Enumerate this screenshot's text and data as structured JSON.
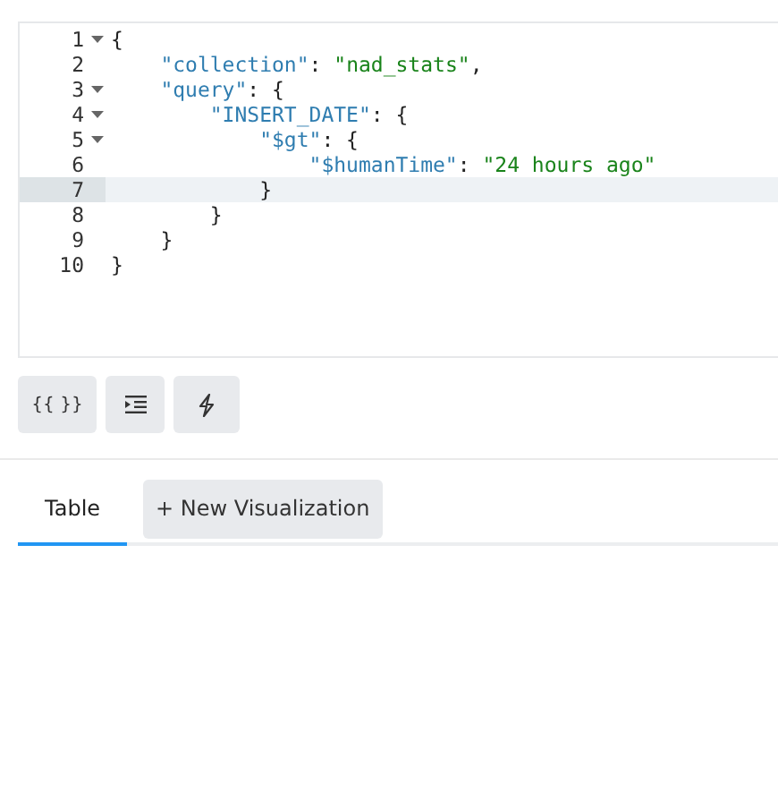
{
  "editor": {
    "lines": [
      {
        "number": "1",
        "foldable": true,
        "active": false,
        "tokens": [
          {
            "kind": "punct",
            "text": "{"
          }
        ]
      },
      {
        "number": "2",
        "foldable": false,
        "active": false,
        "tokens": [
          {
            "kind": "key",
            "text": "    \"collection\""
          },
          {
            "kind": "punct",
            "text": ": "
          },
          {
            "kind": "string",
            "text": "\"nad_stats\""
          },
          {
            "kind": "punct",
            "text": ","
          }
        ]
      },
      {
        "number": "3",
        "foldable": true,
        "active": false,
        "tokens": [
          {
            "kind": "key",
            "text": "    \"query\""
          },
          {
            "kind": "punct",
            "text": ": {"
          }
        ]
      },
      {
        "number": "4",
        "foldable": true,
        "active": false,
        "tokens": [
          {
            "kind": "key",
            "text": "        \"INSERT_DATE\""
          },
          {
            "kind": "punct",
            "text": ": {"
          }
        ]
      },
      {
        "number": "5",
        "foldable": true,
        "active": false,
        "tokens": [
          {
            "kind": "key",
            "text": "            \"$gt\""
          },
          {
            "kind": "punct",
            "text": ": {"
          }
        ]
      },
      {
        "number": "6",
        "foldable": false,
        "active": false,
        "tokens": [
          {
            "kind": "key",
            "text": "                \"$humanTime\""
          },
          {
            "kind": "punct",
            "text": ": "
          },
          {
            "kind": "string",
            "text": "\"24 hours ago\""
          }
        ]
      },
      {
        "number": "7",
        "foldable": false,
        "active": true,
        "tokens": [
          {
            "kind": "punct",
            "text": "            }"
          }
        ]
      },
      {
        "number": "8",
        "foldable": false,
        "active": false,
        "tokens": [
          {
            "kind": "punct",
            "text": "        }"
          }
        ]
      },
      {
        "number": "9",
        "foldable": false,
        "active": false,
        "tokens": [
          {
            "kind": "punct",
            "text": "    }"
          }
        ]
      },
      {
        "number": "10",
        "foldable": false,
        "active": false,
        "tokens": [
          {
            "kind": "punct",
            "text": "}"
          }
        ]
      }
    ]
  },
  "toolbar": [
    {
      "kind": "text",
      "label": "{{ }}"
    },
    {
      "kind": "indent"
    },
    {
      "kind": "bolt"
    }
  ],
  "tabs": [
    {
      "kind": "tab",
      "label": "Table",
      "selected": true
    },
    {
      "kind": "button",
      "label": "+ New Visualization",
      "selected": false
    }
  ]
}
